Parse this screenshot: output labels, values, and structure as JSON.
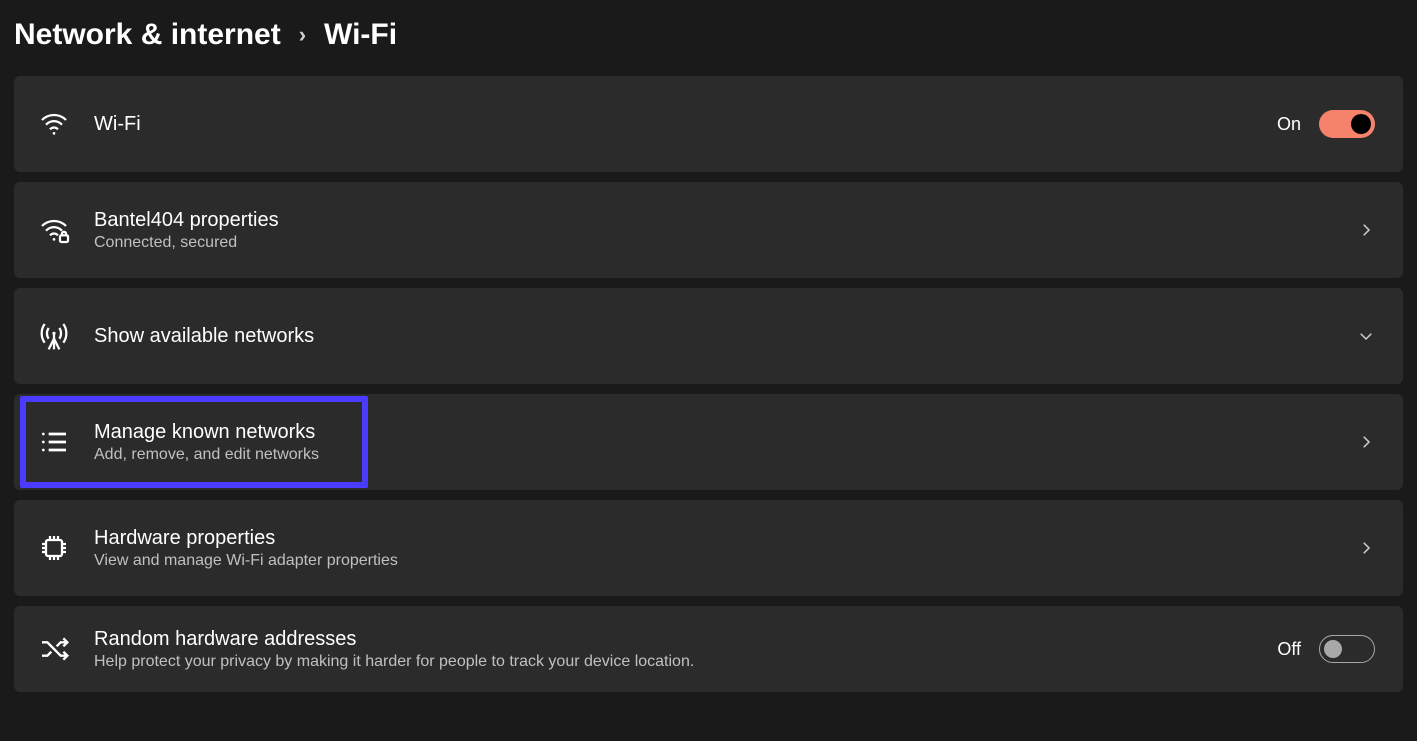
{
  "breadcrumb": {
    "parent": "Network & internet",
    "separator": "›",
    "current": "Wi-Fi"
  },
  "rows": {
    "wifi_toggle": {
      "title": "Wi-Fi",
      "state_label": "On",
      "state": "on"
    },
    "current_network": {
      "title": "Bantel404 properties",
      "subtitle": "Connected, secured"
    },
    "available_networks": {
      "title": "Show available networks"
    },
    "manage_known": {
      "title": "Manage known networks",
      "subtitle": "Add, remove, and edit networks"
    },
    "hardware_props": {
      "title": "Hardware properties",
      "subtitle": "View and manage Wi-Fi adapter properties"
    },
    "random_hw": {
      "title": "Random hardware addresses",
      "subtitle": "Help protect your privacy by making it harder for people to track your device location.",
      "state_label": "Off",
      "state": "off"
    }
  },
  "highlight": {
    "target": "manage-known-networks"
  },
  "colors": {
    "accent_toggle_on": "#f5826a",
    "highlight_border": "#4a3bff"
  }
}
